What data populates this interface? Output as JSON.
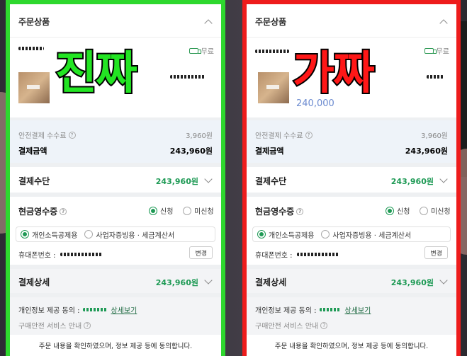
{
  "panels": [
    {
      "variant": "real",
      "caption": "진짜",
      "caption_color": "#23e523",
      "border_color": "#2ed82e",
      "order_title": "주문상품",
      "shipping": "무료",
      "price_partial": "",
      "fee_label": "안전결제 수수료",
      "fee_value": "3,960원",
      "total_label": "결제금액",
      "total_value": "243,960원",
      "method_label": "결제수단",
      "method_value": "243,960원",
      "receipt_label": "현금영수증",
      "apply": "신청",
      "not_apply": "미신청",
      "opt_personal": "개인소득공제용",
      "opt_business": "사업자증빙용 · 세금계산서",
      "phone_label": "휴대폰번호 :",
      "change_btn": "변경",
      "detail_label": "결제상세",
      "detail_value": "243,960원",
      "privacy_label": "개인정보 제공 동의 :",
      "view_detail": "상세보기",
      "safe_service": "구매안전 서비스 안내",
      "confirm_text": "주문 내용을 확인하였으며, 정보 제공 등에 동의합니다."
    },
    {
      "variant": "fake",
      "caption": "가짜",
      "caption_color": "#ff1717",
      "border_color": "#ee1c1c",
      "order_title": "주문상품",
      "shipping": "무료",
      "price_partial": "240,000",
      "fee_label": "안전결제 수수료",
      "fee_value": "3,960원",
      "total_label": "결제금액",
      "total_value": "243,960원",
      "method_label": "결제수단",
      "method_value": "243,960원",
      "receipt_label": "현금영수증",
      "apply": "신청",
      "not_apply": "미신청",
      "opt_personal": "개인소득공제용",
      "opt_business": "사업자증빙용 · 세금계산서",
      "phone_label": "휴대폰번호 :",
      "change_btn": "변경",
      "detail_label": "결제상세",
      "detail_value": "243,960원",
      "privacy_label": "개인정보 제공 동의 :",
      "view_detail": "상세보기",
      "safe_service": "구매안전 서비스 안내",
      "confirm_text": "주문 내용을 확인하였으며, 정보 제공 등에 동의합니다."
    }
  ],
  "colors": {
    "accent_green": "#1e9a55",
    "panel_bg": "#eef0f2"
  },
  "icons": [
    "chevron-up-icon",
    "truck-icon",
    "chevron-down-icon",
    "question-icon",
    "radio-icon"
  ]
}
